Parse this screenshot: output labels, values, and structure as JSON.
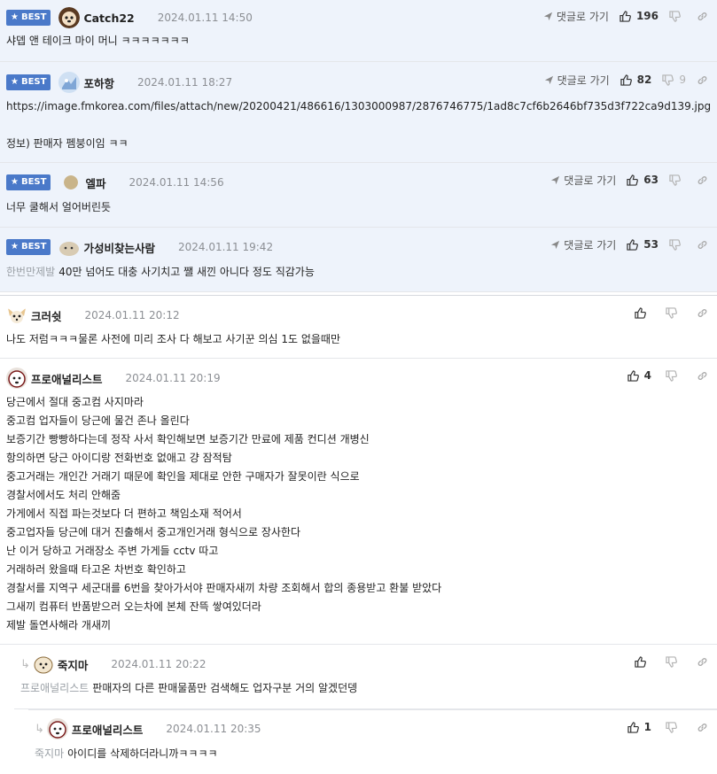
{
  "labels": {
    "best": "BEST",
    "reply_to": "댓글로 가기"
  },
  "comments": [
    {
      "nick": "Catch22",
      "date": "2024.01.11 14:50",
      "up": "196",
      "down": "",
      "lines": [
        "샤뎁 앤 테이크 마이 머니 ㅋㅋㅋㅋㅋㅋㅋ"
      ]
    },
    {
      "nick": "포하항",
      "date": "2024.01.11 18:27",
      "up": "82",
      "down": "9",
      "lines": [
        "https://image.fmkorea.com/files/attach/new/20200421/486616/1303000987/2876746775/1ad8c7cf6b2646bf735d3f722ca9d139.jpg",
        "",
        "정보) 판매자 펨붕이임 ㅋㅋ"
      ]
    },
    {
      "nick": "엘파",
      "date": "2024.01.11 14:56",
      "up": "63",
      "down": "",
      "lines": [
        "너무 쿨해서 얼어버린듯"
      ]
    },
    {
      "nick": "가성비찾는사람",
      "date": "2024.01.11 19:42",
      "up": "53",
      "down": "",
      "mention": "한번만제발",
      "lines": [
        "40만 넘어도 대충 사기치고 쨀 새낀 아니다 정도 직감가능"
      ]
    },
    {
      "nick": "크러쉿",
      "date": "2024.01.11 20:12",
      "up": "",
      "lines": [
        "나도 저럼ㅋㅋㅋ물론 사전에 미리 조사 다 해보고 사기꾼 의심 1도 없을때만"
      ]
    },
    {
      "nick": "프로애널리스트",
      "date": "2024.01.11 20:19",
      "up": "4",
      "lines": [
        "당근에서 절대 중고컴 사지마라",
        "중고컴 업자들이 당근에 물건 존나 올린다",
        "보증기간 빵빵하다는데 정작 사서 확인해보면 보증기간 만료에 제품 컨디션 개병신",
        "항의하면 당근 아이디랑 전화번호 없애고 걍 잠적탐",
        "중고거래는 개인간 거래기 때문에 확인을 제대로 안한 구매자가 잘못이란 식으로",
        "경찰서에서도 처리 안해줌",
        "가게에서 직접 파는것보다 더 편하고 책임소재 적어서",
        "중고업자들 당근에 대거 진출해서 중고개인거래 형식으로 장사한다",
        "난 이거 당하고 거래장소 주변 가게들 cctv 따고",
        "거래하러 왔을때 타고온 차번호 확인하고",
        "경찰서를 지역구 세군대를 6번을 찾아가서야 판매자새끼 차량 조회해서 합의 종용받고 환불 받았다",
        "그새끼 컴퓨터 반품받으러 오는차에 본체 잔뜩 쌓여있더라",
        "제발 돌연사해라 개새끼"
      ]
    },
    {
      "nick": "죽지마",
      "date": "2024.01.11 20:22",
      "up": "",
      "mention": "프로애널리스트",
      "lines": [
        "판매자의 다른 판매물품만 검색해도 업자구분 거의 알겠던뎅"
      ]
    },
    {
      "nick": "프로애널리스트",
      "date": "2024.01.11 20:35",
      "up": "1",
      "mention": "죽지마",
      "lines": [
        "아이디를 삭제하더라니까ㅋㅋㅋㅋ"
      ]
    }
  ]
}
